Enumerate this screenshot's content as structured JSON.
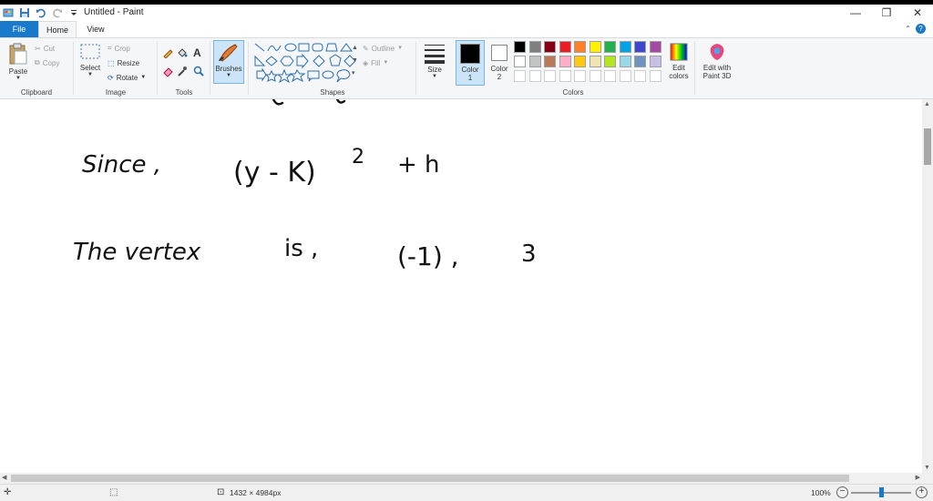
{
  "window": {
    "title": "Untitled - Paint",
    "minimize": "—",
    "restore": "❐",
    "close": "✕"
  },
  "tabs": {
    "file": "File",
    "home": "Home",
    "view": "View"
  },
  "clipboard": {
    "paste": "Paste",
    "cut": "Cut",
    "copy": "Copy",
    "label": "Clipboard"
  },
  "image": {
    "select": "Select",
    "crop": "Crop",
    "resize": "Resize",
    "rotate": "Rotate",
    "label": "Image"
  },
  "tools": {
    "label": "Tools",
    "text_glyph": "A"
  },
  "brushes": {
    "label": "Brushes"
  },
  "shapes": {
    "outline": "Outline",
    "fill": "Fill",
    "label": "Shapes"
  },
  "size": {
    "label": "Size"
  },
  "color1": {
    "label": "Color",
    "num": "1",
    "value": "#000000"
  },
  "color2": {
    "label": "Color",
    "num": "2",
    "value": "#ffffff"
  },
  "colors": {
    "label": "Colors",
    "row1": [
      "#000000",
      "#7f7f7f",
      "#880015",
      "#ed1c24",
      "#ff7f27",
      "#fff200",
      "#22b14c",
      "#00a2e8",
      "#3f48cc",
      "#a349a4"
    ],
    "row2": [
      "#ffffff",
      "#c3c3c3",
      "#b97a57",
      "#ffaec9",
      "#ffc90e",
      "#efe4b0",
      "#b5e61d",
      "#99d9ea",
      "#7092be",
      "#c8bfe7"
    ],
    "row3": [
      "#ffffff",
      "#ffffff",
      "#ffffff",
      "#ffffff",
      "#ffffff",
      "#ffffff",
      "#ffffff",
      "#ffffff",
      "#ffffff",
      "#ffffff"
    ]
  },
  "edit_colors": {
    "line1": "Edit",
    "line2": "colors"
  },
  "paint3d": {
    "line1": "Edit with",
    "line2": "Paint 3D"
  },
  "canvas": {
    "line1_left": "Since ,",
    "line1_expr": "(y - K)",
    "line1_exp": "2",
    "line1_tail": "+ h",
    "line2_left": "The vertex",
    "line2_is": "is ,",
    "line2_paren": "(-1) ,",
    "line2_tail": "3"
  },
  "status": {
    "dimensions": "1432 × 4984px",
    "zoom": "100%"
  }
}
